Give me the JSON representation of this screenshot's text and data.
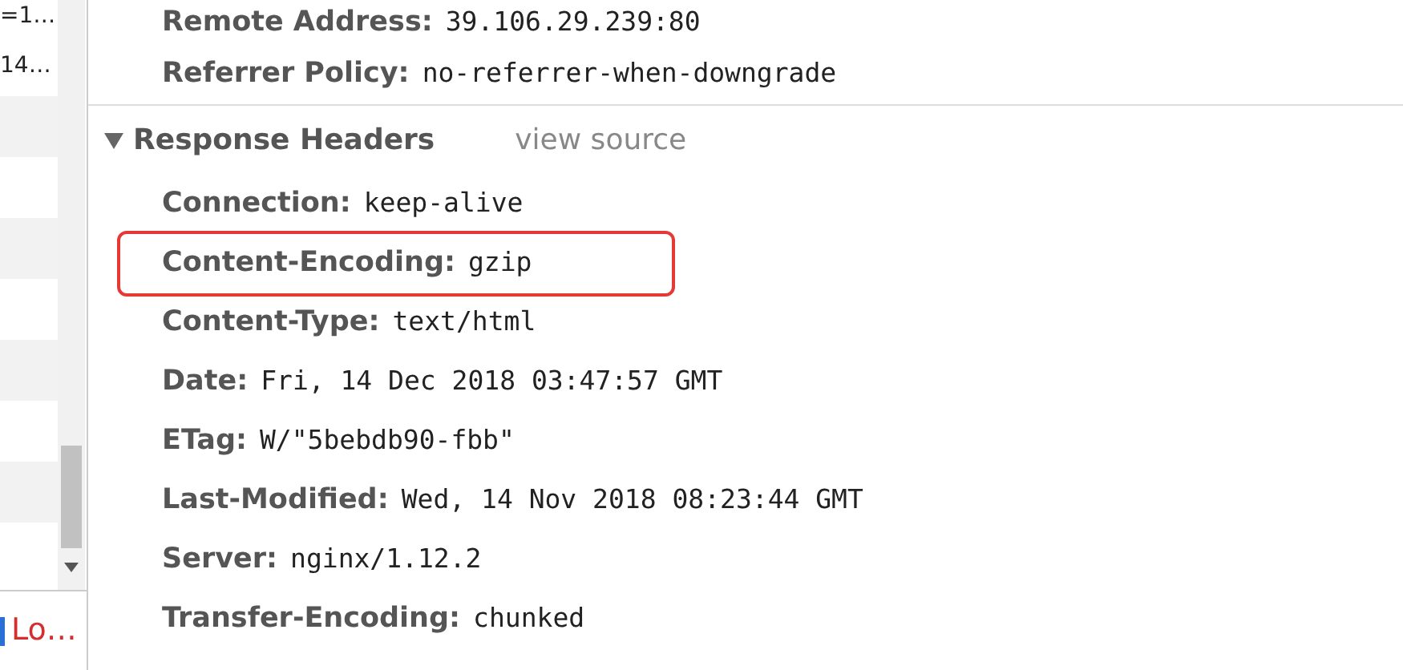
{
  "request_list": {
    "rows": [
      "=1…",
      "14…"
    ],
    "footer": "Lo…"
  },
  "general": {
    "headers": [
      {
        "name": "Remote Address:",
        "value": "39.106.29.239:80",
        "highlighted": false
      },
      {
        "name": "Referrer Policy:",
        "value": "no-referrer-when-downgrade",
        "highlighted": false
      }
    ]
  },
  "response_headers": {
    "title": "Response Headers",
    "expanded": true,
    "link": "view source",
    "headers": [
      {
        "name": "Connection:",
        "value": "keep-alive",
        "highlighted": false
      },
      {
        "name": "Content-Encoding:",
        "value": "gzip",
        "highlighted": true
      },
      {
        "name": "Content-Type:",
        "value": "text/html",
        "highlighted": false
      },
      {
        "name": "Date:",
        "value": "Fri, 14 Dec 2018 03:47:57 GMT",
        "highlighted": false
      },
      {
        "name": "ETag:",
        "value": "W/\"5bebdb90-fbb\"",
        "highlighted": false
      },
      {
        "name": "Last-Modified:",
        "value": "Wed, 14 Nov 2018 08:23:44 GMT",
        "highlighted": false
      },
      {
        "name": "Server:",
        "value": "nginx/1.12.2",
        "highlighted": false
      },
      {
        "name": "Transfer-Encoding:",
        "value": "chunked",
        "highlighted": false
      }
    ]
  }
}
